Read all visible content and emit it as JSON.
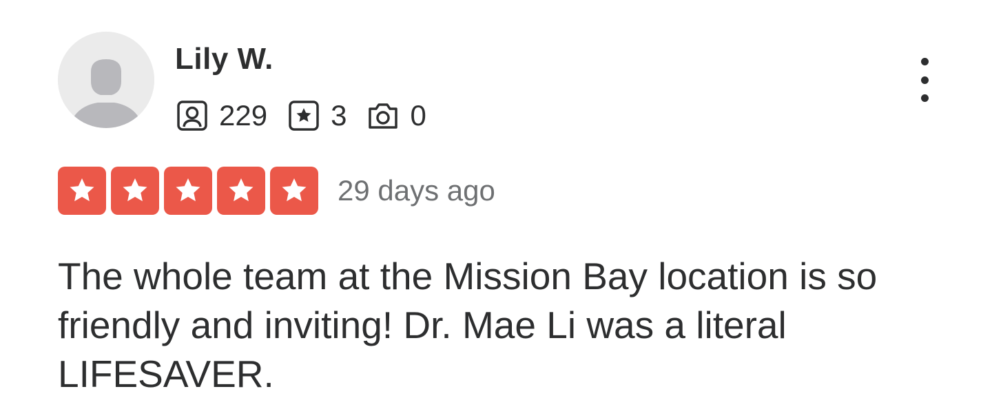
{
  "review": {
    "user": {
      "name": "Lily W.",
      "avatar_icon": "default-user-avatar-icon"
    },
    "stats": {
      "friends": {
        "icon": "friends-icon",
        "count": "229"
      },
      "reviews": {
        "icon": "review-star-icon",
        "count": "3"
      },
      "photos": {
        "icon": "camera-icon",
        "count": "0"
      }
    },
    "more_icon": "more-options-icon",
    "rating": {
      "value": 5,
      "max": 5,
      "star_color": "#eb5849",
      "star_icon": "star-icon"
    },
    "date": "29 days ago",
    "text": "The whole team at the Mission Bay location is so friendly and inviting! Dr. Mae Li was a literal LIFESAVER."
  }
}
